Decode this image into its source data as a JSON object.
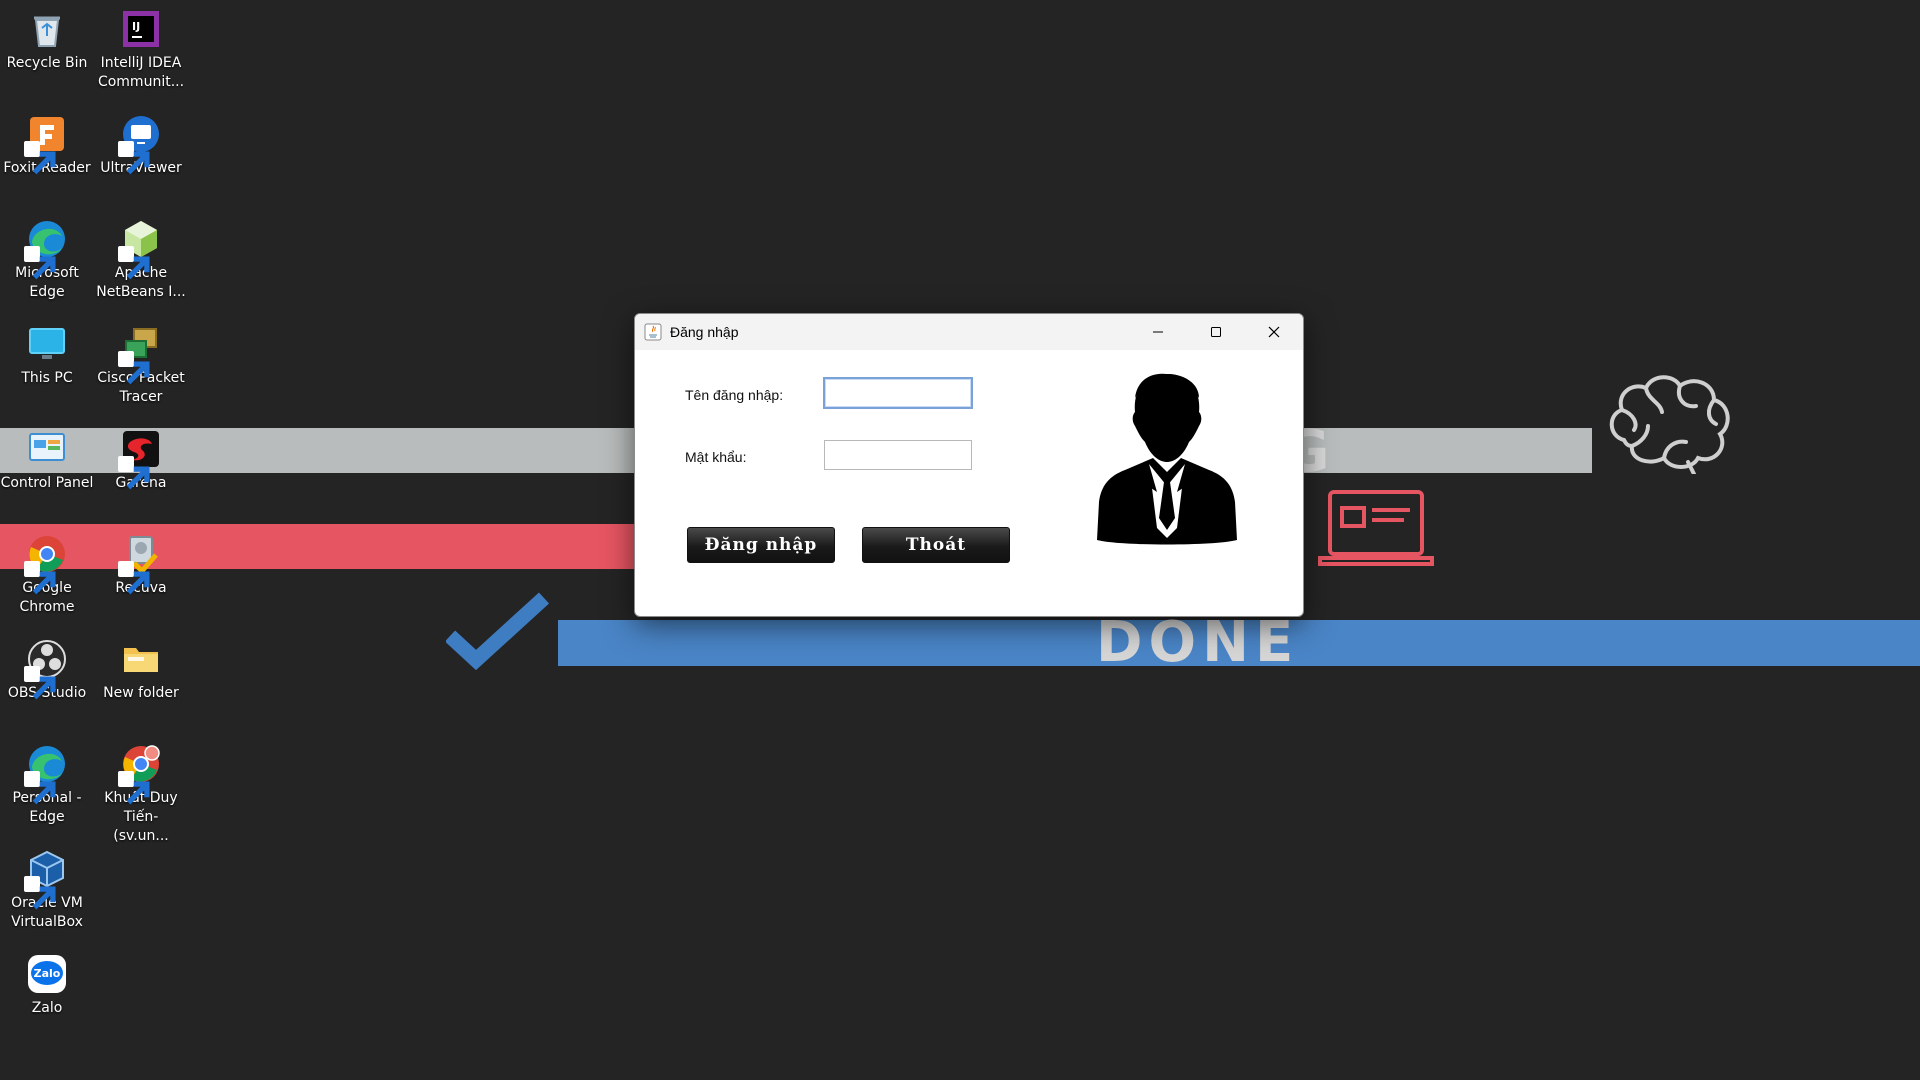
{
  "desktop": {
    "icons": [
      {
        "label": "Recycle Bin",
        "icon": "recycle-bin-icon"
      },
      {
        "label": "IntelliJ IDEA Communit...",
        "icon": "intellij-icon"
      },
      {
        "label": "Foxit Reader",
        "icon": "foxit-reader-icon"
      },
      {
        "label": "UltraViewer",
        "icon": "ultraviewer-icon"
      },
      {
        "label": "Microsoft Edge",
        "icon": "edge-icon"
      },
      {
        "label": "Apache NetBeans I...",
        "icon": "netbeans-icon"
      },
      {
        "label": "This PC",
        "icon": "monitor-icon"
      },
      {
        "label": "Cisco Packet Tracer",
        "icon": "packet-tracer-icon"
      },
      {
        "label": "Control Panel",
        "icon": "control-panel-icon"
      },
      {
        "label": "Garena",
        "icon": "garena-icon"
      },
      {
        "label": "Google Chrome",
        "icon": "chrome-icon"
      },
      {
        "label": "Recuva",
        "icon": "recuva-icon"
      },
      {
        "label": "OBS Studio",
        "icon": "obs-icon"
      },
      {
        "label": "New folder",
        "icon": "folder-icon"
      },
      {
        "label": "Personal - Edge",
        "icon": "edge-icon"
      },
      {
        "label": "Khuất Duy Tiến- (sv.un...",
        "icon": "chrome-profile-icon"
      },
      {
        "label": "Oracle VM VirtualBox",
        "icon": "virtualbox-icon"
      },
      {
        "label": "Zalo",
        "icon": "zalo-icon"
      }
    ]
  },
  "wallpaper": {
    "band_letter": "G",
    "done_text": "DONE",
    "colors": {
      "gray_band": "#b9bcbc",
      "red_band": "#e65562",
      "blue_band": "#4a85c7",
      "background": "#242424"
    }
  },
  "login_window": {
    "title": "Đăng nhập",
    "username_label": "Tên đăng nhập:",
    "username_value": "",
    "password_label": "Mật khẩu:",
    "password_value": "",
    "login_button": "Đăng nhập",
    "exit_button": "Thoát"
  }
}
